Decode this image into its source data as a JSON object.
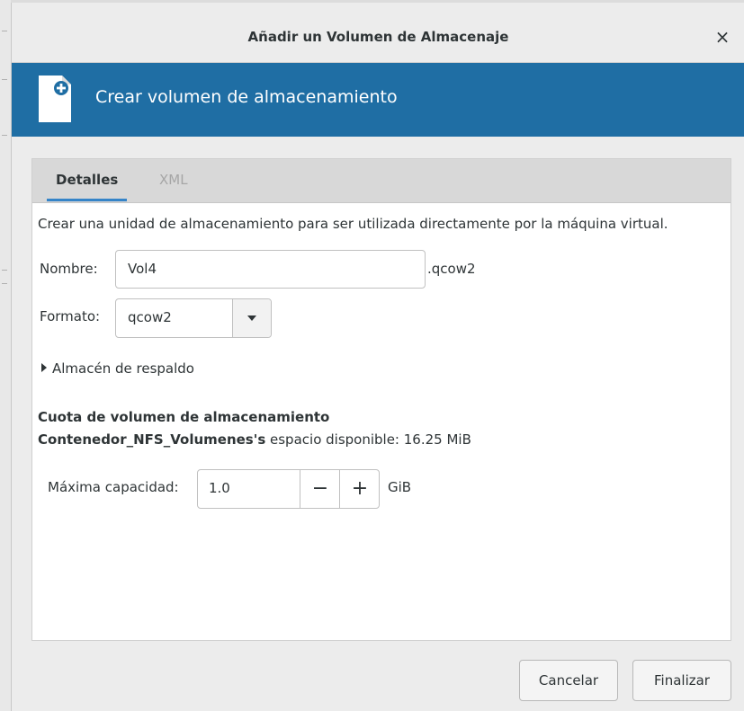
{
  "window": {
    "title": "Añadir un Volumen de Almacenaje",
    "close_glyph": "×"
  },
  "banner": {
    "heading": "Crear volumen de almacenamiento",
    "icon": "document-add-icon",
    "color": "#1f6ea4"
  },
  "tabs": [
    {
      "label": "Detalles",
      "active": true
    },
    {
      "label": "XML",
      "active": false
    }
  ],
  "details": {
    "description": "Crear una unidad de almacenamiento para ser utilizada directamente por la máquina virtual.",
    "name_label": "Nombre:",
    "name_value": "Vol4",
    "name_suffix": ".qcow2",
    "format_label": "Formato:",
    "format_value": "qcow2",
    "backing_label": "Almacén de respaldo"
  },
  "quota": {
    "title": "Cuota de volumen de almacenamiento",
    "pool_name": "Contenedor_NFS_Volumenes's",
    "available_text": " espacio disponible: 16.25 MiB",
    "capacity_label": "Máxima capacidad:",
    "capacity_value": "1.0",
    "minus": "−",
    "plus": "+",
    "unit": "GiB"
  },
  "footer": {
    "cancel_label": "Cancelar",
    "finish_label": "Finalizar"
  }
}
